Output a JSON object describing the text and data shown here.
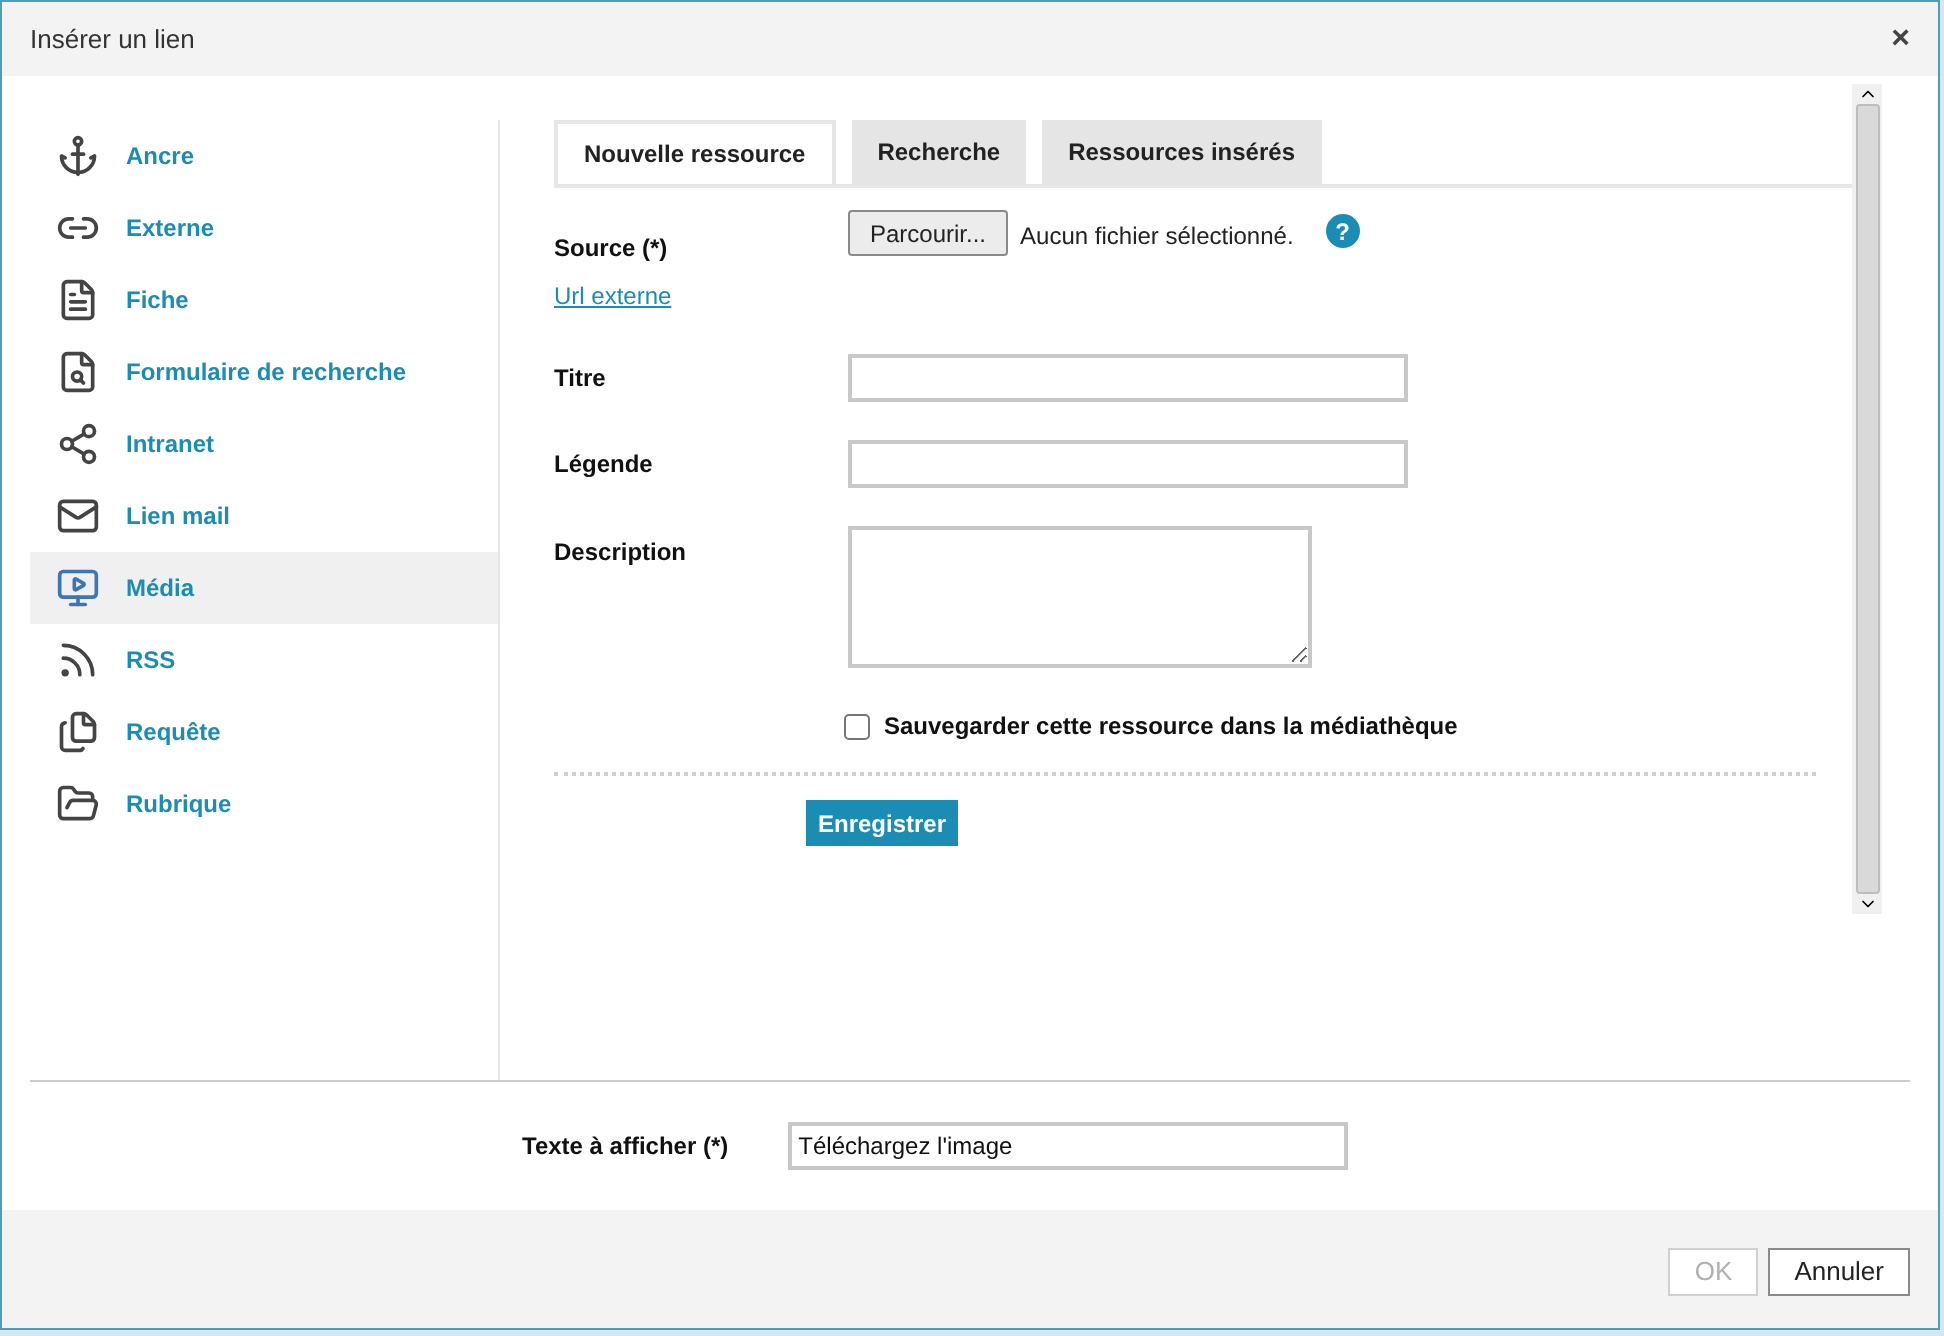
{
  "window": {
    "title": "Insérer un lien",
    "close": "×"
  },
  "sidebar": {
    "items": [
      {
        "label": "Ancre",
        "kind": "anchor",
        "selected": false
      },
      {
        "label": "Externe",
        "kind": "link",
        "selected": false
      },
      {
        "label": "Fiche",
        "kind": "file",
        "selected": false
      },
      {
        "label": "Formulaire de recherche",
        "kind": "search-file",
        "selected": false
      },
      {
        "label": "Intranet",
        "kind": "network",
        "selected": false
      },
      {
        "label": "Lien mail",
        "kind": "mail",
        "selected": false
      },
      {
        "label": "Média",
        "kind": "media",
        "selected": true
      },
      {
        "label": "RSS",
        "kind": "rss",
        "selected": false
      },
      {
        "label": "Requête",
        "kind": "files",
        "selected": false
      },
      {
        "label": "Rubrique",
        "kind": "folder",
        "selected": false
      }
    ]
  },
  "tabs": [
    {
      "label": "Nouvelle ressource",
      "selected": true
    },
    {
      "label": "Recherche",
      "selected": false
    },
    {
      "label": "Ressources insérés",
      "selected": false
    }
  ],
  "form": {
    "source_label": "Source (*)",
    "browse_button": "Parcourir...",
    "file_status": "Aucun fichier sélectionné.",
    "help": "?",
    "external_url_link": "Url externe",
    "title_label": "Titre",
    "caption_label": "Légende",
    "description_label": "Description",
    "save_checkbox": {
      "label": "Sauvegarder cette ressource dans la médiathèque",
      "checked": false
    },
    "save_button": "Enregistrer"
  },
  "display_text": {
    "label": "Texte à afficher (*)",
    "value": "Téléchargez l'image"
  },
  "footer": {
    "ok_button": {
      "label": "OK",
      "disabled": true
    },
    "cancel_button": {
      "label": "Annuler",
      "disabled": false
    }
  }
}
